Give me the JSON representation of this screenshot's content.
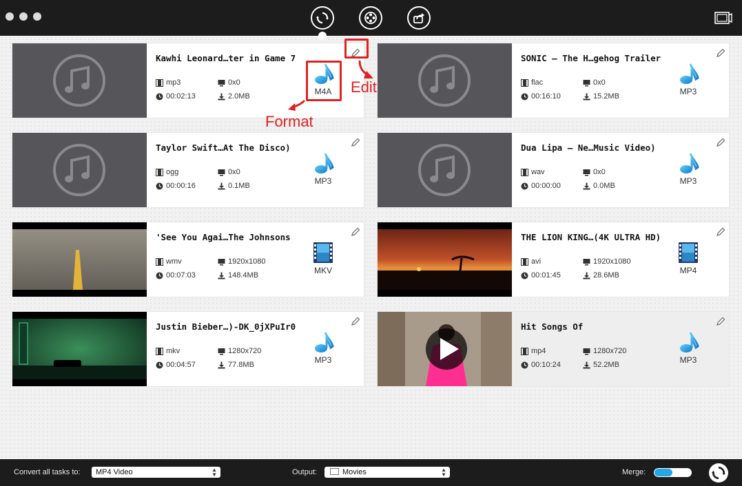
{
  "toolbar": {
    "modes": [
      "convert",
      "media-browser",
      "share"
    ],
    "active_mode": "convert"
  },
  "cards": [
    {
      "title": "Kawhi Leonard…ter in Game 7",
      "container": "mp3",
      "resolution": "0x0",
      "duration": "00:02:13",
      "size": "2.0MB",
      "format_label": "M4A",
      "format_kind": "audio",
      "thumbnail": "music-placeholder"
    },
    {
      "title": "SONIC – The H…gehog Trailer",
      "container": "flac",
      "resolution": "0x0",
      "duration": "00:16:10",
      "size": "15.2MB",
      "format_label": "MP3",
      "format_kind": "audio",
      "thumbnail": "music-placeholder"
    },
    {
      "title": "Taylor Swift…At The Disco)",
      "container": "ogg",
      "resolution": "0x0",
      "duration": "00:00:16",
      "size": "0.1MB",
      "format_label": "MP3",
      "format_kind": "audio",
      "thumbnail": "music-placeholder"
    },
    {
      "title": "Dua Lipa – Ne…Music Video)",
      "container": "wav",
      "resolution": "0x0",
      "duration": "00:00:00",
      "size": "0.0MB",
      "format_label": "MP3",
      "format_kind": "audio",
      "thumbnail": "music-placeholder"
    },
    {
      "title": "'See You Agai…The Johnsons",
      "container": "wmv",
      "resolution": "1920x1080",
      "duration": "00:07:03",
      "size": "148.4MB",
      "format_label": "MKV",
      "format_kind": "video",
      "thumbnail": "road"
    },
    {
      "title": "THE LION KING…(4K ULTRA HD)",
      "container": "avi",
      "resolution": "1920x1080",
      "duration": "00:01:45",
      "size": "28.6MB",
      "format_label": "MP4",
      "format_kind": "video",
      "thumbnail": "sunset"
    },
    {
      "title": "Justin Bieber…)-DK_0jXPuIr0",
      "container": "mkv",
      "resolution": "1280x720",
      "duration": "00:04:57",
      "size": "77.8MB",
      "format_label": "MP3",
      "format_kind": "audio",
      "thumbnail": "night-street"
    },
    {
      "title": "Hit Songs Of",
      "container": "mp4",
      "resolution": "1280x720",
      "duration": "00:10:24",
      "size": "52.2MB",
      "format_label": "MP3",
      "format_kind": "audio",
      "thumbnail": "pink-dancer"
    }
  ],
  "annotations": {
    "edit_label": "Edit",
    "format_label": "Format"
  },
  "bottom": {
    "convert_all_label": "Convert all tasks to:",
    "convert_all_value": "MP4 Video",
    "output_label": "Output:",
    "output_value": "Movies",
    "merge_label": "Merge:",
    "merge_on": true
  },
  "colors": {
    "accent": "#27a6e6",
    "annotation": "#e02020",
    "toolbar": "#1c1c1c"
  }
}
